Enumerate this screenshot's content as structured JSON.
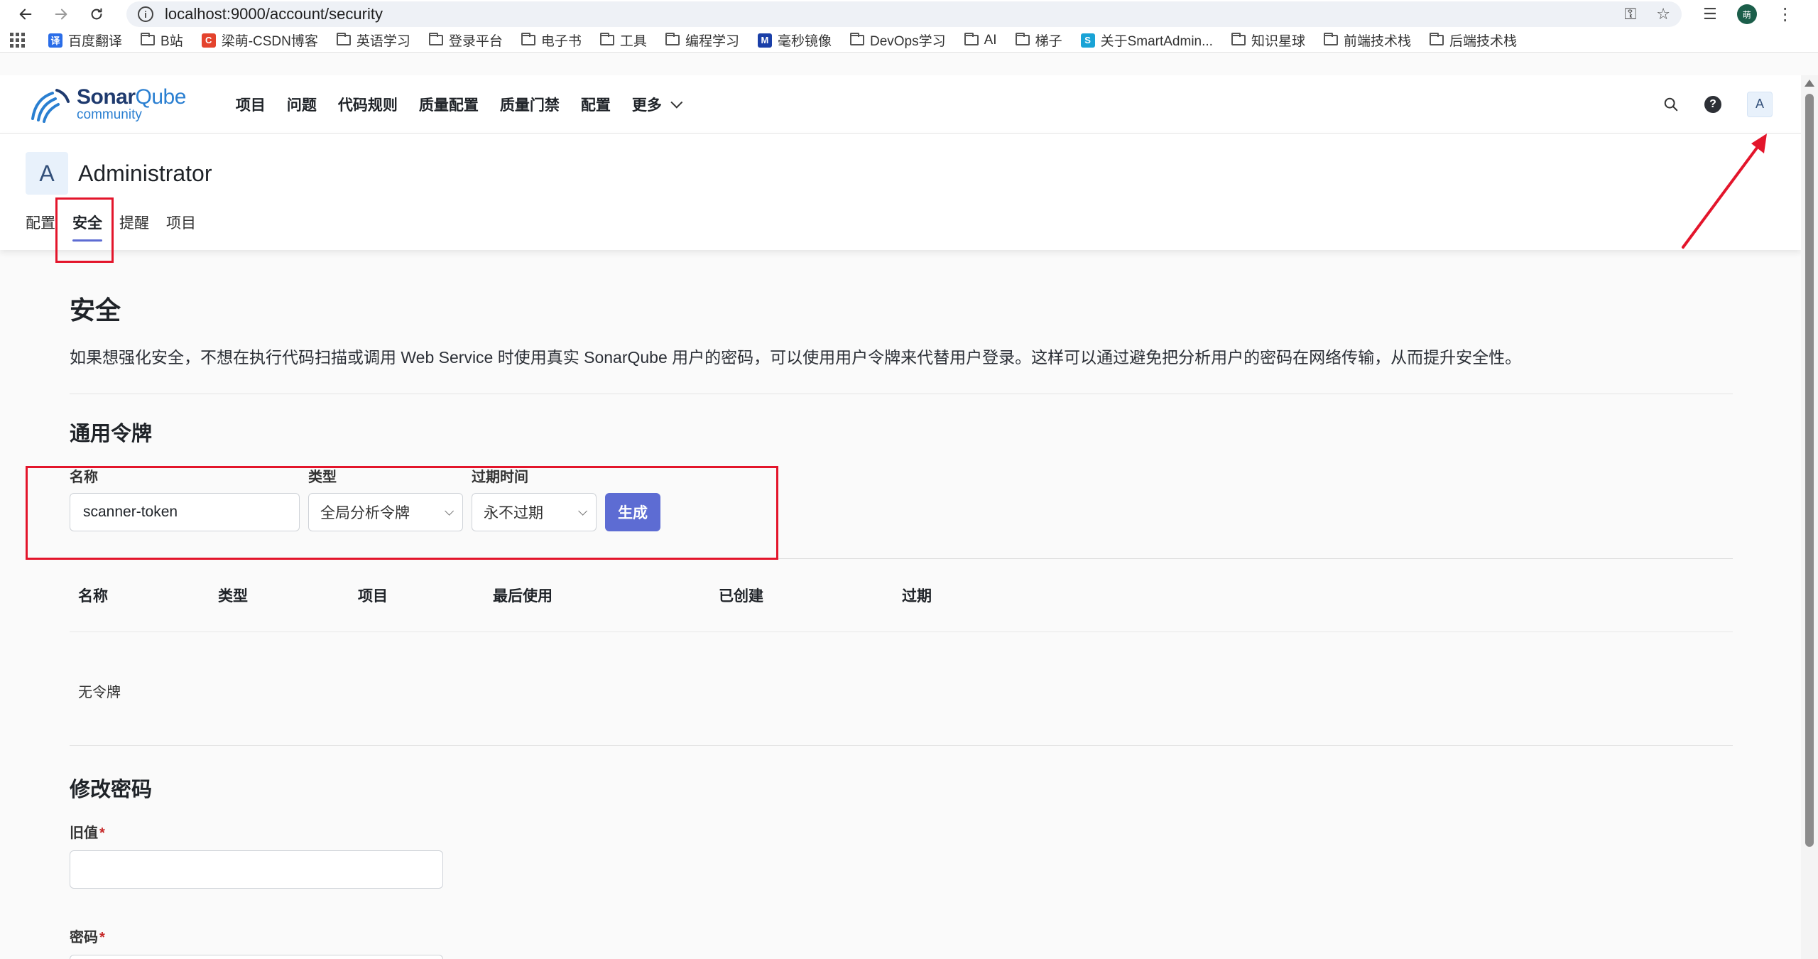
{
  "browser": {
    "url": "localhost:9000/account/security",
    "profile_initial": "萌",
    "bookmarks": [
      {
        "type": "fav",
        "label": "百度翻译",
        "color": "#2a6de8",
        "glyph": "译"
      },
      {
        "type": "folder",
        "label": "B站"
      },
      {
        "type": "fav",
        "label": "梁萌-CSDN博客",
        "color": "#e4432d",
        "glyph": "C"
      },
      {
        "type": "folder",
        "label": "英语学习"
      },
      {
        "type": "folder",
        "label": "登录平台"
      },
      {
        "type": "folder",
        "label": "电子书"
      },
      {
        "type": "folder",
        "label": "工具"
      },
      {
        "type": "folder",
        "label": "编程学习"
      },
      {
        "type": "fav",
        "label": "毫秒镜像",
        "color": "#1a3fa8",
        "glyph": "M"
      },
      {
        "type": "folder",
        "label": "DevOps学习"
      },
      {
        "type": "folder",
        "label": "AI"
      },
      {
        "type": "folder",
        "label": "梯子"
      },
      {
        "type": "fav",
        "label": "关于SmartAdmin...",
        "color": "#19a3d6",
        "glyph": "S"
      },
      {
        "type": "folder",
        "label": "知识星球"
      },
      {
        "type": "folder",
        "label": "前端技术栈"
      },
      {
        "type": "folder",
        "label": "后端技术栈"
      }
    ]
  },
  "header": {
    "logo_main_a": "Sonar",
    "logo_main_b": "Qube",
    "logo_sub": "community",
    "nav": [
      "项目",
      "问题",
      "代码规则",
      "质量配置",
      "质量门禁",
      "配置",
      "更多"
    ],
    "avatar_initial": "A"
  },
  "account": {
    "avatar_initial": "A",
    "name": "Administrator",
    "tabs": [
      "配置",
      "安全",
      "提醒",
      "项目"
    ],
    "active_tab": "安全"
  },
  "security": {
    "title": "安全",
    "description": "如果想强化安全，不想在执行代码扫描或调用 Web Service 时使用真实 SonarQube 用户的密码，可以使用用户令牌来代替用户登录。这样可以通过避免把分析用户的密码在网络传输，从而提升安全性。",
    "tokens_title": "通用令牌",
    "form": {
      "name_label": "名称",
      "name_value": "scanner-token",
      "type_label": "类型",
      "type_value": "全局分析令牌",
      "expire_label": "过期时间",
      "expire_value": "永不过期",
      "generate_label": "生成"
    },
    "table": {
      "columns": [
        "名称",
        "类型",
        "项目",
        "最后使用",
        "已创建",
        "过期"
      ],
      "empty": "无令牌"
    },
    "password": {
      "title": "修改密码",
      "old_label": "旧值",
      "new_label": "密码",
      "required_mark": "*"
    }
  },
  "colors": {
    "accent": "#5d6cd3",
    "annotation": "#e3152b"
  }
}
